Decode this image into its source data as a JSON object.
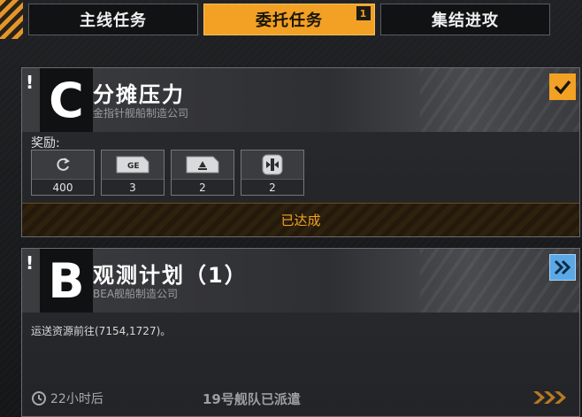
{
  "tabs": [
    {
      "label": "主线任务",
      "active": false
    },
    {
      "label": "委托任务",
      "active": true,
      "badge": "1"
    },
    {
      "label": "集结进攻",
      "active": false
    }
  ],
  "missions": [
    {
      "grade": "C",
      "alert": "!",
      "title": "分摊压力",
      "issuer": "金指针舰船制造公司",
      "status_icon": "checkmark-icon",
      "reward_label": "奖励:",
      "rewards": [
        {
          "icon": "refresh-icon",
          "count": "400"
        },
        {
          "icon": "ge-chip-icon",
          "count": "3"
        },
        {
          "icon": "triangle-chip-icon",
          "count": "2"
        },
        {
          "icon": "module-icon",
          "count": "2"
        }
      ],
      "status_text": "已达成"
    },
    {
      "grade": "B",
      "alert": "!",
      "title": "观测计划（1）",
      "issuer": "BEA舰船制造公司",
      "status_icon": "double-chevron-right-icon",
      "description": "运送资源前往(7154,1727)。",
      "timer": "22小时后",
      "fleet_status": "19号舰队已派遣"
    }
  ],
  "colors": {
    "accent": "#f2a124",
    "info_blue": "#5ba8e6",
    "background": "#1a1b1d"
  }
}
